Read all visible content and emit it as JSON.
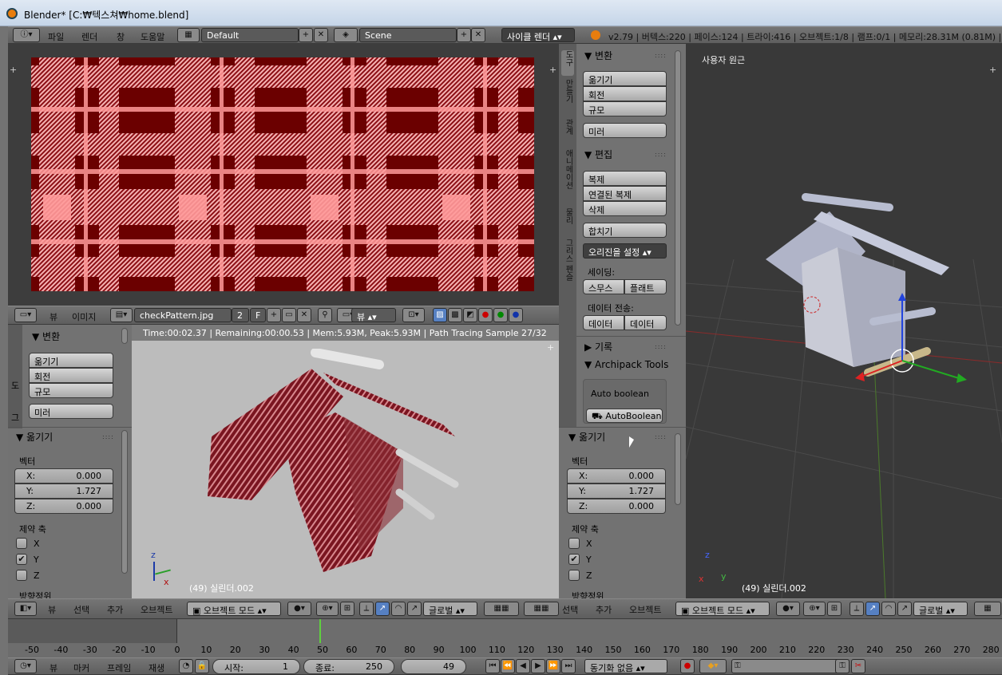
{
  "window": {
    "title": "Blender* [C:₩텍스쳐₩home.blend]"
  },
  "info_header": {
    "menus": [
      "파일",
      "렌더",
      "창",
      "도움말"
    ],
    "screen": "Default",
    "scene": "Scene",
    "engine": "사이클 렌더",
    "status": "v2.79 | 버텍스:220 | 페이스:124 | 트라이:416 | 오브젝트:1/8 | 램프:0/1 | 메모리:28.31M (0.81M) |"
  },
  "image_editor": {
    "menus": [
      "뷰",
      "이미지"
    ],
    "image_name": "checkPattern.jpg",
    "users": "2",
    "fake": "F",
    "view_mode": "뷰"
  },
  "render_view": {
    "stats": "Time:00:02.37 | Remaining:00:00.53 | Mem:5.93M, Peak:5.93M | Path Tracing Sample 27/32",
    "object_label": "(49) 실린더.002"
  },
  "left_tools": {
    "transform_title": "변환",
    "buttons": [
      "옮기기",
      "회전",
      "규모",
      "미러"
    ],
    "tabs": [
      "도",
      "그"
    ]
  },
  "left_op": {
    "title": "옮기기",
    "vector_label": "벡터",
    "x_label": "X:",
    "x": "0.000",
    "y_label": "Y:",
    "y": "1.727",
    "z_label": "Z:",
    "z": "0.000",
    "constraint_label": "제약 축",
    "axes": [
      "X",
      "Y",
      "Z"
    ],
    "orient_label": "방향정위"
  },
  "tool_shelf": {
    "tabs": [
      "도구",
      "만들기",
      "관계",
      "애니메이션",
      "물리",
      "그리스 펜슬"
    ],
    "transform_title": "변환",
    "transform_buttons": [
      "옮기기",
      "회전",
      "규모"
    ],
    "mirror": "미러",
    "edit_title": "편집",
    "edit_buttons": [
      "복제",
      "연결된 복제",
      "삭제"
    ],
    "join": "합치기",
    "set_origin": "오리진을 설정",
    "shading_label": "세이딩:",
    "smooth": "스무스",
    "flat": "플래트",
    "data_transfer_label": "데이터 전송:",
    "data1": "데이터",
    "data2": "데이터",
    "history_title": "기록",
    "archipack_title": "Archipack Tools",
    "auto_boolean_label": "Auto boolean",
    "auto_boolean_btn": "AutoBoolean"
  },
  "right_op": {
    "title": "옮기기",
    "vector_label": "벡터",
    "x_label": "X:",
    "x": "0.000",
    "y_label": "Y:",
    "y": "1.727",
    "z_label": "Z:",
    "z": "0.000",
    "constraint_label": "제약 축",
    "axes": [
      "X",
      "Y",
      "Z"
    ],
    "orient_label": "방향정위"
  },
  "viewport": {
    "label": "사용자 원근",
    "object_label": "(49) 실린더.002"
  },
  "view3d_header_left": {
    "menus": [
      "뷰",
      "선택",
      "추가",
      "오브젝트"
    ],
    "mode": "오브젝트 모드",
    "orientation": "글로벌"
  },
  "view3d_header_right": {
    "menus": [
      "선택",
      "추가",
      "오브젝트"
    ],
    "mode": "오브젝트 모드",
    "orientation": "글로벌"
  },
  "timeline": {
    "ticks": [
      "-50",
      "-40",
      "-30",
      "-20",
      "-10",
      "0",
      "10",
      "20",
      "30",
      "40",
      "50",
      "60",
      "70",
      "80",
      "90",
      "100",
      "110",
      "120",
      "130",
      "140",
      "150",
      "160",
      "170",
      "180",
      "190",
      "200",
      "210",
      "220",
      "230",
      "240",
      "250",
      "260",
      "270",
      "280"
    ],
    "current_frame_marker": 49,
    "menus": [
      "뷰",
      "마커",
      "프레임",
      "재생"
    ],
    "start_label": "시작:",
    "start": "1",
    "end_label": "종료:",
    "end": "250",
    "current": "49",
    "sync": "동기화 없음"
  },
  "colors": {
    "accent": "#5680c2",
    "playhead": "#5fcf3f",
    "tartan_dark": "#6b0000",
    "tartan_light": "#ff8f8f"
  }
}
